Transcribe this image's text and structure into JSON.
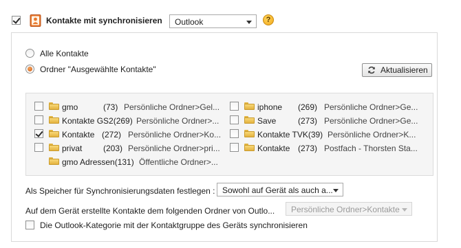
{
  "header": {
    "sync_checkbox_checked": true,
    "title": "Kontakte mit synchronisieren",
    "source_dropdown": "Outlook",
    "help_glyph": "?"
  },
  "selection": {
    "all_contacts": "Alle Kontakte",
    "selected_folder": "Ordner \"Ausgewählte Kontakte\"",
    "selected_option": "selected_folder",
    "refresh_button": "Aktualisieren"
  },
  "folders_left": [
    {
      "name": "gmo",
      "count": "(73)",
      "path": "Persönliche Ordner>Gel...",
      "checked": false
    },
    {
      "name": "Kontakte GS2(269)",
      "count": "",
      "path": "Persönliche Ordner>...",
      "checked": false
    },
    {
      "name": "Kontakte",
      "count": "(272)",
      "path": "Persönliche Ordner>Ko...",
      "checked": true
    },
    {
      "name": "privat",
      "count": "(203)",
      "path": "Persönliche Ordner>pri...",
      "checked": false
    },
    {
      "name": "gmo Adressen(131)",
      "count": "",
      "path": "Öffentliche Ordner>...",
      "checked": false
    }
  ],
  "folders_right": [
    {
      "name": "iphone",
      "count": "(269)",
      "path": "Persönliche Ordner>Ge...",
      "checked": false
    },
    {
      "name": "Save",
      "count": "(273)",
      "path": "Persönliche Ordner>Ge...",
      "checked": false
    },
    {
      "name": "Kontakte TVK(39)",
      "count": "",
      "path": "Persönliche Ordner>K...",
      "checked": false
    },
    {
      "name": "Kontakte",
      "count": "(273)",
      "path": "Postfach - Thorsten Sta...",
      "checked": false
    }
  ],
  "storage": {
    "label": "Als Speicher für Synchronisierungsdaten festlegen :",
    "value": "Sowohl auf Gerät als auch a..."
  },
  "target": {
    "label": "Auf dem Gerät erstellte Kontakte dem folgenden Ordner von Outlo...",
    "value": "Persönliche Ordner>Kontakte"
  },
  "category": {
    "label": "Die Outlook-Kategorie mit der Kontaktgruppe des Geräts synchronisieren",
    "checked": false
  },
  "icons": {
    "contacts": "contacts-book-icon",
    "help": "help-icon",
    "refresh": "refresh-icon",
    "folder": "folder-icon"
  },
  "colors": {
    "help_icon": "#f2b01e",
    "radio_selected": "#d2601a",
    "panel_border": "#d9d9d9",
    "list_background": "#f5f5f5"
  }
}
